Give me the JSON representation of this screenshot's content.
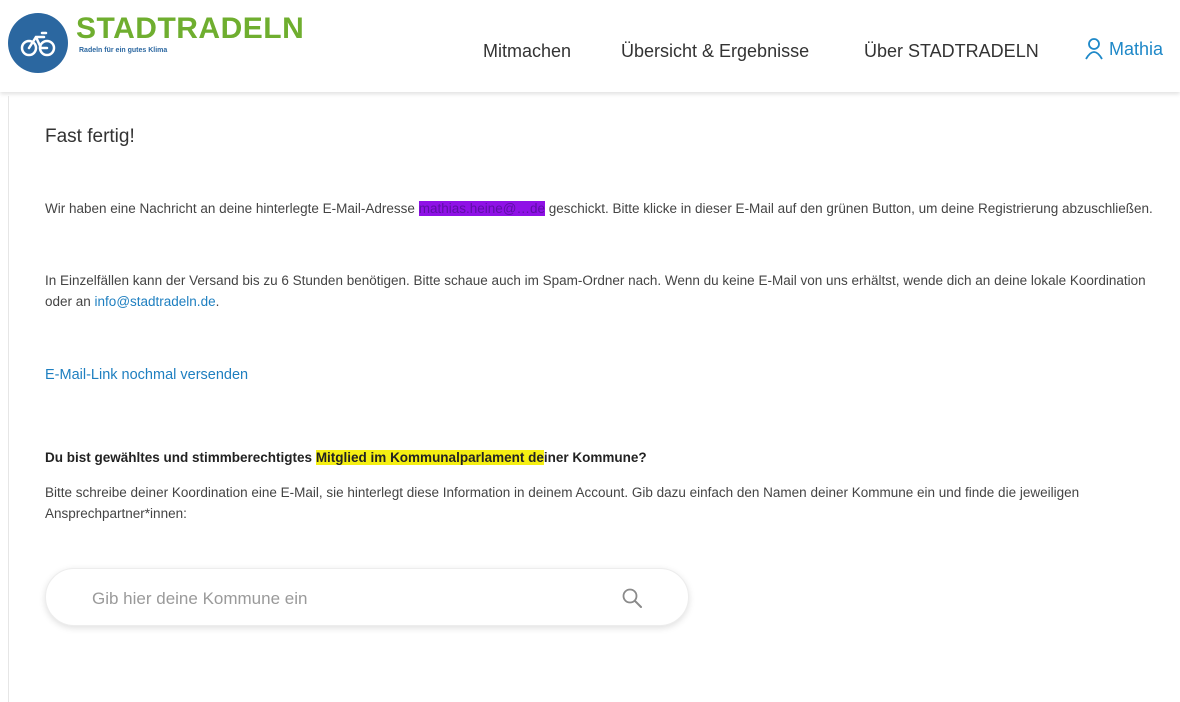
{
  "brand": {
    "name": "STADTRADELN",
    "tagline": "Radeln für ein gutes Klima",
    "color_green": "#6fae2f",
    "color_blue": "#2b67a0"
  },
  "nav": {
    "items": [
      "Mitmachen",
      "Übersicht & Ergebnisse",
      "Über STADTRADELN"
    ],
    "user_label": "Mathia",
    "user_icon": "user-icon"
  },
  "main": {
    "title": "Fast fertig!",
    "para1_before": "Wir haben eine Nachricht an deine hinterlegte E-Mail-Adresse ",
    "para1_email_redacted": "mathias.heine@…de",
    "para1_after": " geschickt. Bitte klicke in dieser E-Mail auf den grünen Button, um deine Registrierung abzuschließen.",
    "para2_before": "In Einzelfällen kann der Versand bis zu 6 Stunden benötigen. Bitte schaue auch im Spam-Ordner nach. Wenn du keine E-Mail von uns erhältst, wende dich an deine lokale Koordination oder an ",
    "para2_link": "info@stadtradeln.de",
    "para2_after": ".",
    "resend_link": "E-Mail-Link nochmal versenden",
    "question_before": "Du bist gewähltes und stimmberechtigtes ",
    "question_highlight": "Mitglied im Kommunalparlament de",
    "question_after": "iner Kommune?",
    "info_text": "Bitte schreibe deiner Koordination eine E-Mail, sie hinterlegt diese Information in deinem Account. Gib dazu einfach den Namen deiner Kommune ein und finde die jeweiligen Ansprechpartner*innen:",
    "search_placeholder": "Gib hier deine Kommune ein",
    "search_icon": "search-icon",
    "link_color": "#1e7fc0",
    "highlight_color": "#f5ef12"
  }
}
